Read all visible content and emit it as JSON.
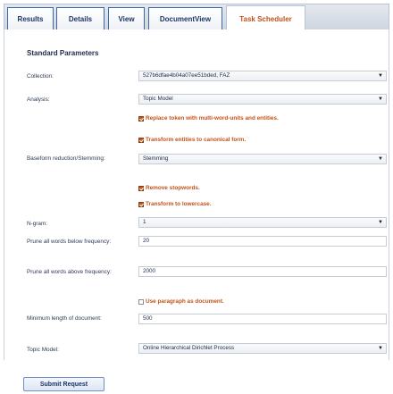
{
  "tabs": [
    {
      "label": "Results",
      "active": false
    },
    {
      "label": "Details",
      "active": false
    },
    {
      "label": "View",
      "active": false
    },
    {
      "label": "DocumentView",
      "active": false
    },
    {
      "label": "Task Scheduler",
      "active": true
    }
  ],
  "section_title": "Standard Parameters",
  "form": {
    "collection": {
      "label": "Collection:",
      "value": "527b6dfae4b04a07ee51bded, FAZ"
    },
    "analysis": {
      "label": "Analysis:",
      "value": "Topic Model"
    },
    "replace_tokens": {
      "label": "Replace token with multi-word-units and entities.",
      "checked": true
    },
    "transform_entities": {
      "label": "Transform entities to canonical form.",
      "checked": true
    },
    "baseform": {
      "label": "Baseform reduction/Stemming:",
      "value": "Stemming"
    },
    "remove_stopwords": {
      "label": "Remove stopwords.",
      "checked": true
    },
    "lowercase": {
      "label": "Transform to lowercase.",
      "checked": true
    },
    "ngram": {
      "label": "N-gram:",
      "value": "1"
    },
    "prune_below": {
      "label": "Prune all words below frequency:",
      "value": "20"
    },
    "prune_above": {
      "label": "Prune all words above frequency:",
      "value": "2000"
    },
    "use_paragraph": {
      "label": "Use paragraph as document.",
      "checked": false
    },
    "min_length": {
      "label": "Minimum length of document:",
      "value": "500"
    },
    "topic_model": {
      "label": "Topic Model:",
      "value": "Online Hierarchical Dirichlet Process"
    }
  },
  "submit_label": "Submit Request",
  "colors": {
    "accent": "#c0531a",
    "tab_border": "#3f67a6",
    "text": "#1d2b4a"
  }
}
